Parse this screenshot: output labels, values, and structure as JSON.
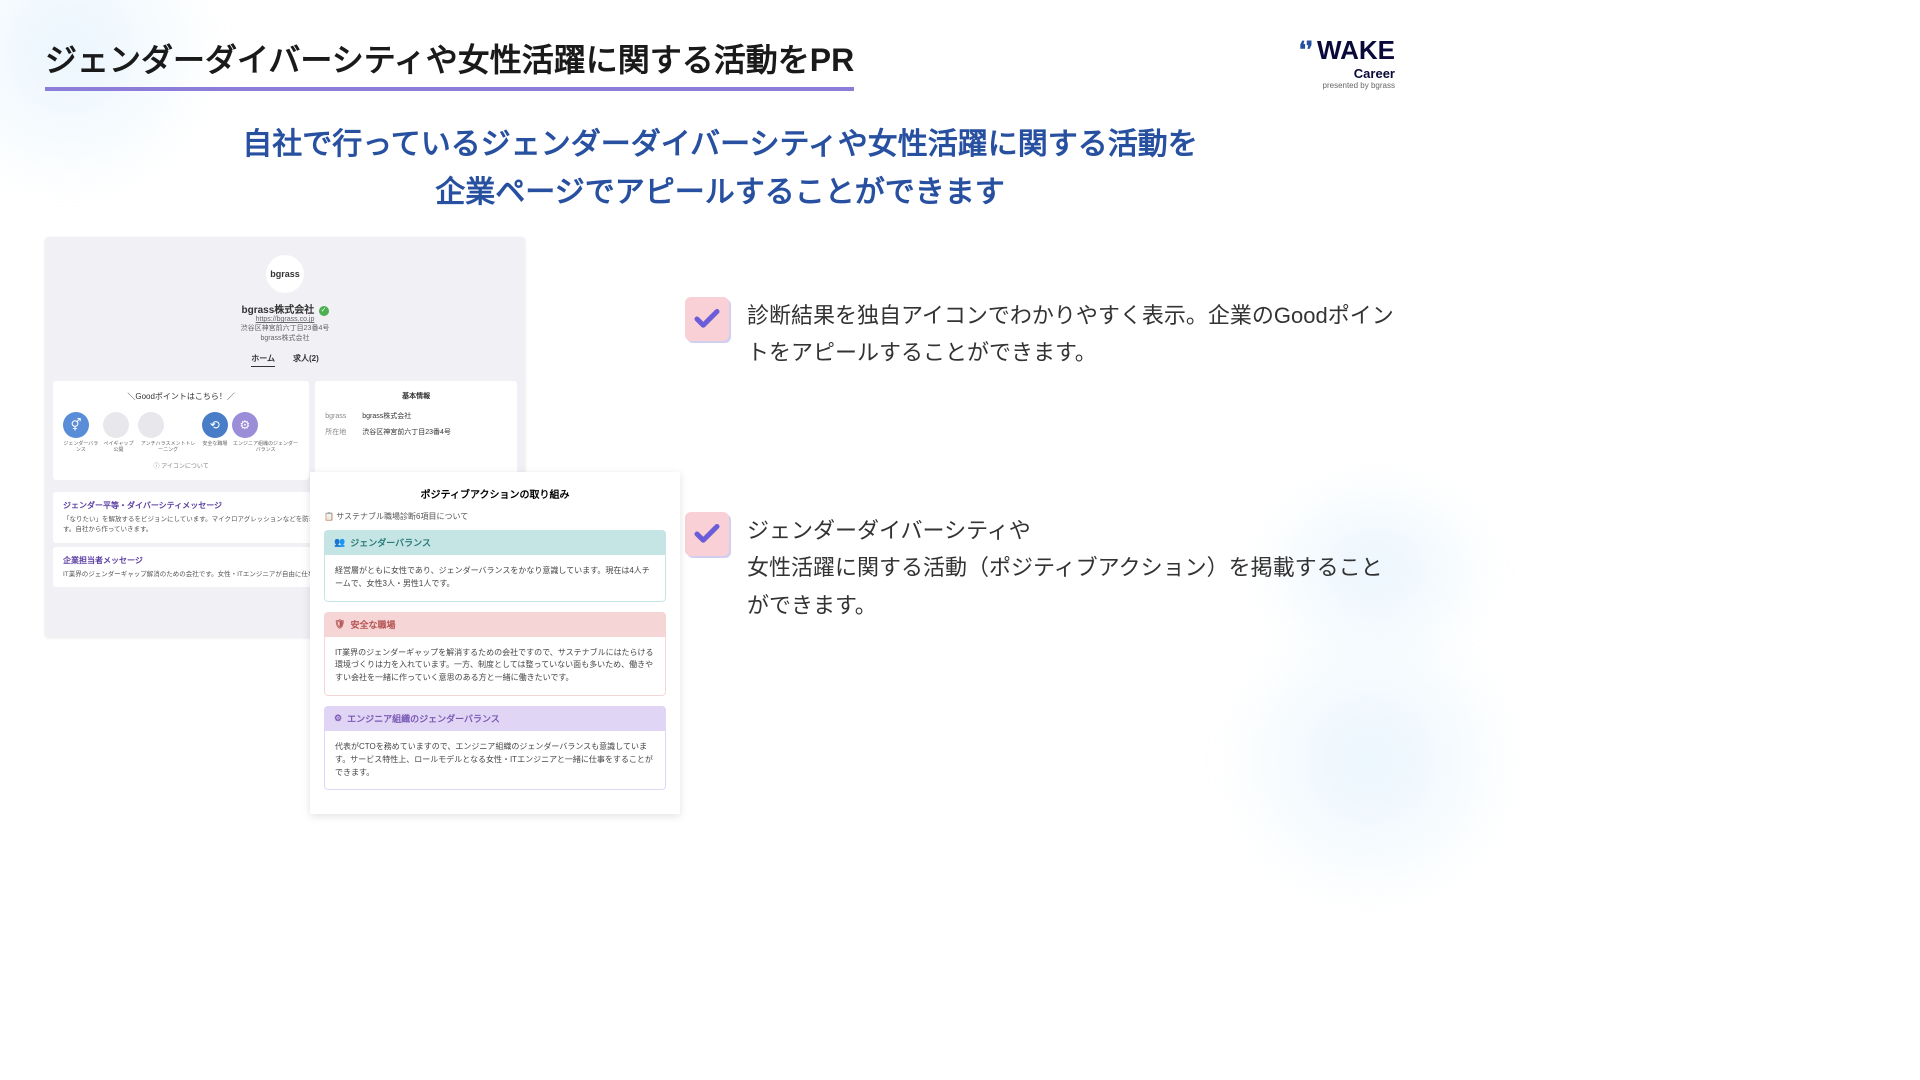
{
  "title": "ジェンダーダイバーシティや女性活躍に関する活動をPR",
  "brand": {
    "name": "WAKE",
    "sub": "Career",
    "presented": "presented by bgrass"
  },
  "subtitle_l1": "自社で行っているジェンダーダイバーシティや女性活躍に関する活動を",
  "subtitle_l2": "企業ページでアピールすることができます",
  "mock1": {
    "logo_text": "bgrass",
    "company": "bgrass株式会社",
    "url": "https://bgrass.co.jp",
    "addr1": "渋谷区神宮前六丁目23番4号",
    "addr2": "bgrass株式会社",
    "tabs": {
      "home": "ホーム",
      "jobs": "求人(2)"
    },
    "good_title": "＼Goodポイントはこちら！／",
    "icon_note": "ⓘ アイコンについて",
    "icons": [
      {
        "label": "ジェンダーバランス"
      },
      {
        "label": "ペイギャップ公開"
      },
      {
        "label": "アンチハラスメントトレーニング"
      },
      {
        "label": "安全な職場"
      },
      {
        "label": "エンジニア組織のジェンダーバランス"
      }
    ],
    "basic_title": "基本情報",
    "basic_name_label": "bgrass",
    "basic_name": "bgrass株式会社",
    "basic_loc_label": "所在地",
    "basic_loc": "渋谷区神宮前六丁目23番4号",
    "sec1_title": "ジェンダー平等・ダイバーシティメッセージ",
    "sec1_body": "「なりたい」を解放するをビジョンにしています。マイクロアグレッションなどを防ぎ、よりその人の持てる力を十分に発揮できる社会を作っていきます。自社から作っていきます。",
    "sec2_title": "企業担当者メッセージ",
    "sec2_body": "IT業界のジェンダーギャップ解消のための会社です。女性・ITエンジニアが自由に仕事を作っていきたい方と共に働きたいです。"
  },
  "mock2": {
    "title": "ポジティブアクションの取り組み",
    "note": "サステナブル職場診断6項目について",
    "cards": [
      {
        "header": "ジェンダーバランス",
        "body": "経営層がともに女性であり、ジェンダーバランスをかなり意識しています。現在は4人チームで、女性3人・男性1人です。"
      },
      {
        "header": "安全な職場",
        "body": "IT業界のジェンダーギャップを解消するための会社ですので、サステナブルにはたらける環境づくりは力を入れています。一方、制度としては整っていない面も多いため、働きやすい会社を一緒に作っていく意思のある方と一緒に働きたいです。"
      },
      {
        "header": "エンジニア組織のジェンダーバランス",
        "body": "代表がCTOを務めていますので、エンジニア組織のジェンダーバランスも意識しています。サービス特性上、ロールモデルとなる女性・ITエンジニアと一緒に仕事をすることができます。"
      }
    ]
  },
  "features": [
    "診断結果を独自アイコンでわかりやすく表示。企業のGoodポイントをアピールすることができます。",
    "ジェンダーダイバーシティや\n女性活躍に関する活動（ポジティブアクション）を掲載することができます。"
  ]
}
